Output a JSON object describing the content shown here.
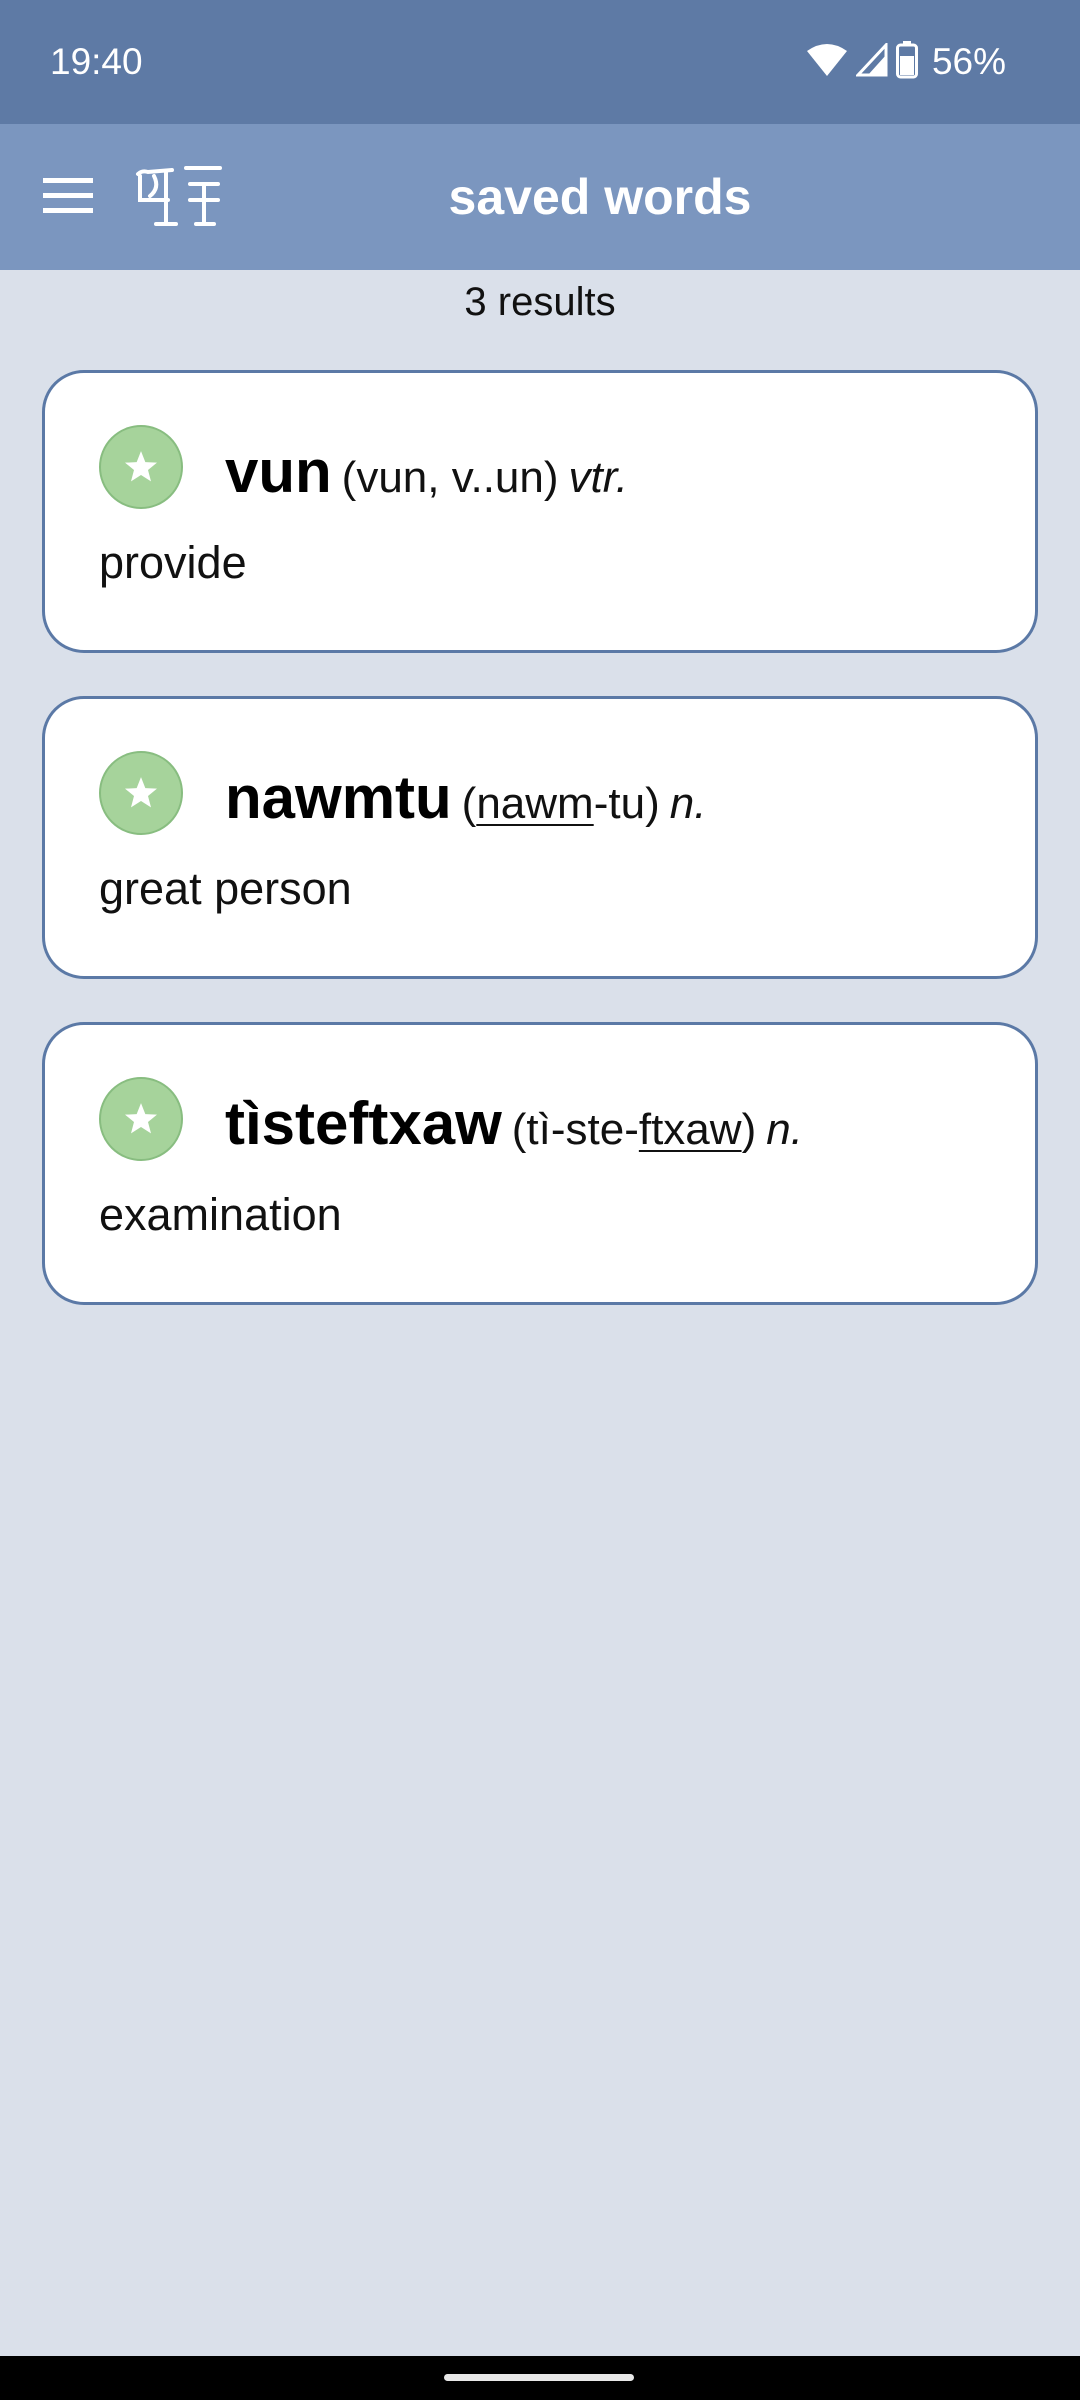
{
  "status_bar": {
    "time": "19:40",
    "battery_percent": "56%",
    "icons": [
      "wifi-icon",
      "cell-signal-icon",
      "battery-icon"
    ]
  },
  "app_bar": {
    "menu_icon": "hamburger-menu-icon",
    "logo_icon": "app-logo-icon",
    "title": "saved words"
  },
  "results": {
    "count_label": "3 results"
  },
  "words": [
    {
      "headword": "vun",
      "pronunciation": {
        "open": "(",
        "parts": [
          {
            "text": "vun",
            "stressed": false
          },
          {
            "text": ", v..un",
            "stressed": false
          }
        ],
        "close": ")"
      },
      "part_of_speech": "vtr.",
      "definition": "provide",
      "starred": true
    },
    {
      "headword": "nawmtu",
      "pronunciation": {
        "open": "(",
        "parts": [
          {
            "text": "nawm",
            "stressed": true
          },
          {
            "text": "-tu",
            "stressed": false
          }
        ],
        "close": ")"
      },
      "part_of_speech": "n.",
      "definition": "great person",
      "starred": true
    },
    {
      "headword": "tìsteftxaw",
      "pronunciation": {
        "open": "(",
        "parts": [
          {
            "text": "tì-ste-",
            "stressed": false
          },
          {
            "text": "ftxaw",
            "stressed": true
          }
        ],
        "close": ")"
      },
      "part_of_speech": "n.",
      "definition": "examination",
      "starred": true
    }
  ],
  "colors": {
    "status_bar": "#5e7aa5",
    "app_bar": "#7b96bf",
    "background": "#dae0ea",
    "card_border": "#5b79a6",
    "star_fill": "#a6d39b"
  }
}
